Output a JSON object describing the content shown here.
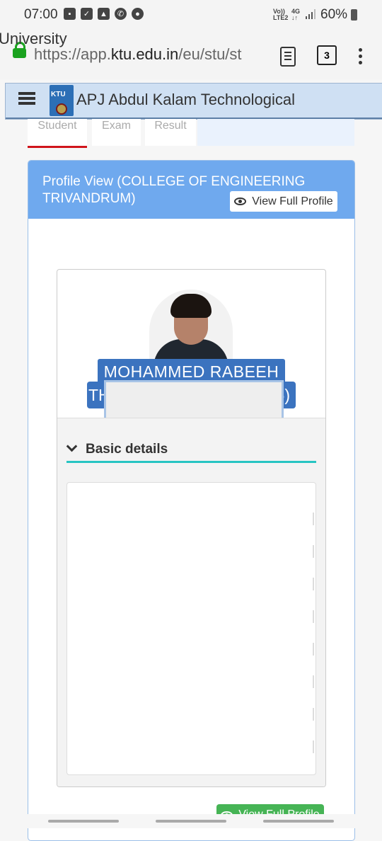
{
  "status_bar": {
    "time": "07:00",
    "icons": [
      "lock-icon",
      "checkbox-icon",
      "image-icon",
      "whatsapp-icon",
      "firefox-icon"
    ],
    "network_top": "Vo))",
    "network_bottom": "LTE2",
    "net_top": "4G",
    "net_bottom": "↓↑",
    "battery_percent": "60%"
  },
  "browser": {
    "url_prefix": "https://app.",
    "url_domain": "ktu.edu.in",
    "url_suffix": "/eu/stu/st",
    "tab_count": "3"
  },
  "header": {
    "logo_text": "KTU",
    "title_line1": "APJ Abdul Kalam Technological",
    "title_line2": "University"
  },
  "tabs": [
    {
      "label": "Student"
    },
    {
      "label": "Exam"
    },
    {
      "label": "Result"
    }
  ],
  "profile": {
    "title": "Profile View (COLLEGE OF ENGINEERING TRIVANDRUM)",
    "view_full_profile": "View Full Profile",
    "name": "MOHAMMED RABEEH",
    "second_line_left": "TH",
    "second_line_right": "6)",
    "basic_details": "Basic details"
  },
  "colors": {
    "header_blue": "#6fa9ee",
    "badge_blue": "#3b73bf",
    "accent_teal": "#27c4c2",
    "active_tab_red": "#d0141b",
    "green_button": "#46b455"
  }
}
